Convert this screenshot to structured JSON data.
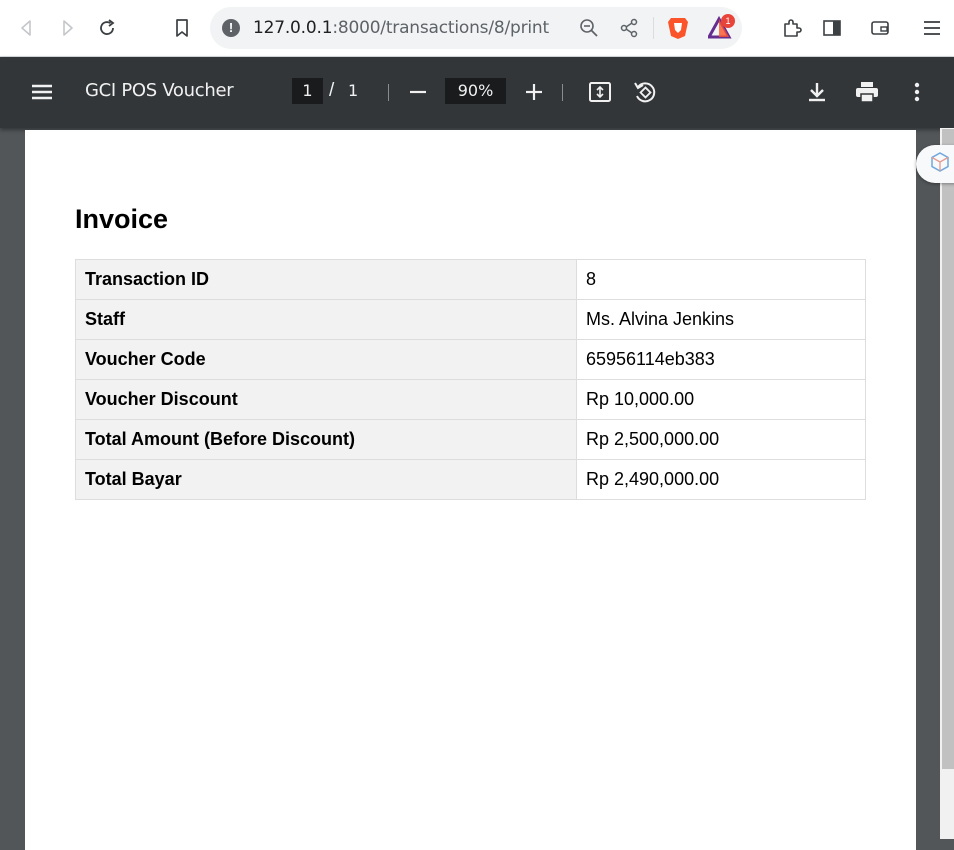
{
  "browser": {
    "url_host": "127.0.0.1",
    "url_path": ":8000/transactions/8/print",
    "notification_badge": "1"
  },
  "pdf_toolbar": {
    "title": "GCI POS Voucher",
    "current_page": "1",
    "page_separator": "/",
    "total_pages": "1",
    "zoom": "90%"
  },
  "document": {
    "heading": "Invoice",
    "rows": [
      {
        "label": "Transaction ID",
        "value": "8"
      },
      {
        "label": "Staff",
        "value": "Ms. Alvina Jenkins"
      },
      {
        "label": "Voucher Code",
        "value": "65956114eb383"
      },
      {
        "label": "Voucher Discount",
        "value": "Rp 10,000.00"
      },
      {
        "label": "Total Amount (Before Discount)",
        "value": "Rp 2,500,000.00"
      },
      {
        "label": "Total Bayar",
        "value": "Rp 2,490,000.00"
      }
    ]
  },
  "colors": {
    "pdf_toolbar_bg": "#323639",
    "viewer_bg": "#525659",
    "label_cell_bg": "#f2f2f2",
    "badge": "#e8443a"
  },
  "icons": [
    "back-icon",
    "forward-icon",
    "reload-icon",
    "bookmark-icon",
    "info-icon",
    "zoom-out-icon",
    "share-icon",
    "brave-shield-icon",
    "brave-rewards-icon",
    "extensions-icon",
    "sidebar-icon",
    "wallet-icon",
    "menu-icon",
    "pdf-menu-icon",
    "pdf-zoom-out-icon",
    "pdf-zoom-in-icon",
    "fit-page-icon",
    "rotate-icon",
    "download-icon",
    "print-icon",
    "more-icon"
  ]
}
